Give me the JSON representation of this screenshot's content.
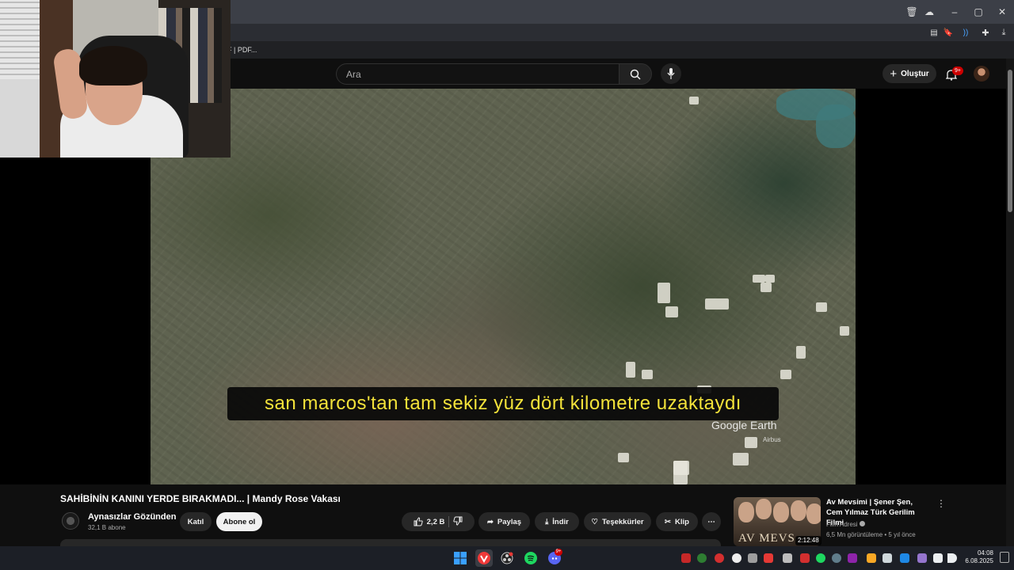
{
  "browser": {
    "bookmark_fragment": "F | PDF..."
  },
  "youtube": {
    "search_placeholder": "Ara",
    "create_label": "Oluştur",
    "notification_count": "9+"
  },
  "video": {
    "subtitle": "san marcos'tan tam sekiz yüz dört kilometre uzaktaydı",
    "watermark": "Google Earth",
    "credit": "Airbus",
    "title": "SAHİBİNİN KANINI YERDE BIRAKMADI... | Mandy Rose Vakası"
  },
  "channel": {
    "name": "Aynasızlar Gözünden",
    "subscribers": "32,1 B abone",
    "join_label": "Katıl",
    "subscribe_label": "Abone ol"
  },
  "actions": {
    "likes": "2,2 B",
    "share": "Paylaş",
    "download": "İndir",
    "thanks": "Teşekkürler",
    "clip": "Klip"
  },
  "recommendation": {
    "title": "Av Mevsimi | Şener Şen, Cem Yılmaz Türk Gerilim Filmi",
    "channel": "Film Adresi",
    "meta": "6,5 Mn görüntüleme • 5 yıl önce",
    "duration": "2:12:48",
    "thumb_text": "AV MEVS"
  },
  "taskbar": {
    "time": "04:08",
    "date": "6.08.2025",
    "discord_badge": "9+"
  },
  "colors": {
    "subtitle_text": "#f3e23a",
    "youtube_bg": "#0f0f0f",
    "notification_red": "#cc0000"
  }
}
